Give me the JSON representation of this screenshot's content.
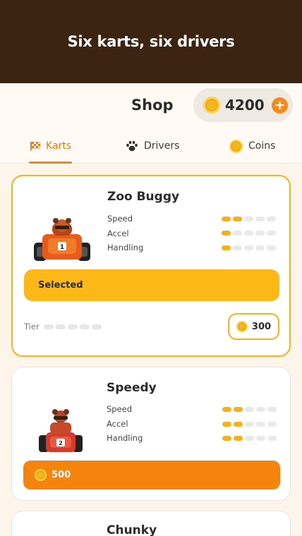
{
  "banner": {
    "title": "Six karts, six drivers"
  },
  "header": {
    "title": "Shop",
    "coins": "4200",
    "plus": "+"
  },
  "tabs": [
    {
      "label": "Karts",
      "icon": "flag-icon",
      "active": true
    },
    {
      "label": "Drivers",
      "icon": "paw-icon",
      "active": false
    },
    {
      "label": "Coins",
      "icon": "coin-icon",
      "active": false
    }
  ],
  "stats_labels": {
    "speed": "Speed",
    "accel": "Accel",
    "handling": "Handling"
  },
  "karts": [
    {
      "name": "Zoo Buggy",
      "speed": 2,
      "accel": 1,
      "handling": 1,
      "button": "Selected",
      "tier_label": "Tier",
      "tier": 0,
      "price": "300",
      "selected": true
    },
    {
      "name": "Speedy",
      "speed": 2,
      "accel": 2,
      "handling": 2,
      "button_price": "500",
      "selected": false
    },
    {
      "name": "Chunky"
    }
  ],
  "stat_max": 5,
  "colors": {
    "accent": "#f4840e",
    "selected": "#fbb816",
    "banner": "#3b2412",
    "bar_on": "#f4b217"
  }
}
